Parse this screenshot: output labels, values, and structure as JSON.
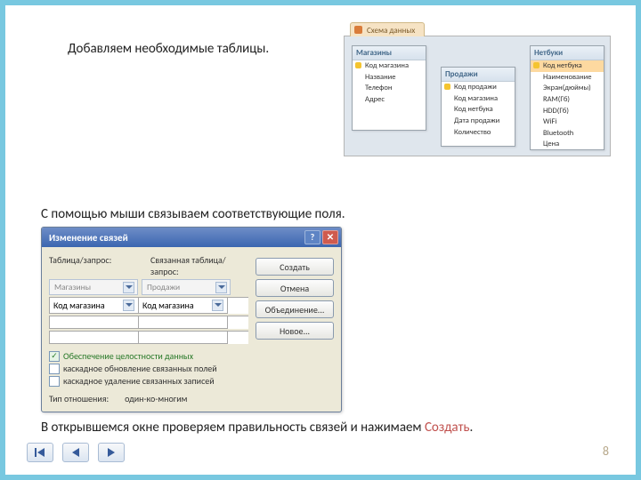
{
  "text": {
    "line1": "Добавляем необходимые таблицы.",
    "line2": "С помощью мыши связываем соответствующие поля.",
    "line3a": "В открывшемся окне проверяем правильность связей и нажимаем",
    "line3b": "Создать",
    "line3c": "."
  },
  "schema": {
    "tab": "Схема данных",
    "tables": [
      {
        "title": "Магазины",
        "fields": [
          {
            "label": "Код магазина",
            "key": true
          },
          {
            "label": "Название"
          },
          {
            "label": "Телефон"
          },
          {
            "label": "Адрес"
          }
        ]
      },
      {
        "title": "Продажи",
        "fields": [
          {
            "label": "Код продажи",
            "key": true
          },
          {
            "label": "Код магазина"
          },
          {
            "label": "Код нетбука"
          },
          {
            "label": "Дата продажи"
          },
          {
            "label": "Количество"
          }
        ]
      },
      {
        "title": "Нетбуки",
        "fields": [
          {
            "label": "Код нетбука",
            "key": true,
            "hl": true
          },
          {
            "label": "Наименование"
          },
          {
            "label": "Экран(дюймы)"
          },
          {
            "label": "RAM(Гб)"
          },
          {
            "label": "HDD(Гб)"
          },
          {
            "label": "WiFi"
          },
          {
            "label": "Bluetooth"
          },
          {
            "label": "Цена"
          }
        ]
      }
    ]
  },
  "dialog": {
    "title": "Изменение связей",
    "lbl_table": "Таблица/запрос:",
    "lbl_related": "Связанная таблица/запрос:",
    "dd_left": "Магазины",
    "dd_right": "Продажи",
    "cell_left": "Код магазина",
    "cell_right": "Код магазина",
    "buttons": {
      "create": "Создать",
      "cancel": "Отмена",
      "join": "Объединение...",
      "new": "Новое..."
    },
    "checks": {
      "integrity": "Обеспечение целостности данных",
      "cascade_update": "каскадное обновление связанных полей",
      "cascade_delete": "каскадное удаление связанных записей"
    },
    "rel_label": "Тип отношения:",
    "rel_value": "один-ко-многим"
  },
  "page_num": "8"
}
